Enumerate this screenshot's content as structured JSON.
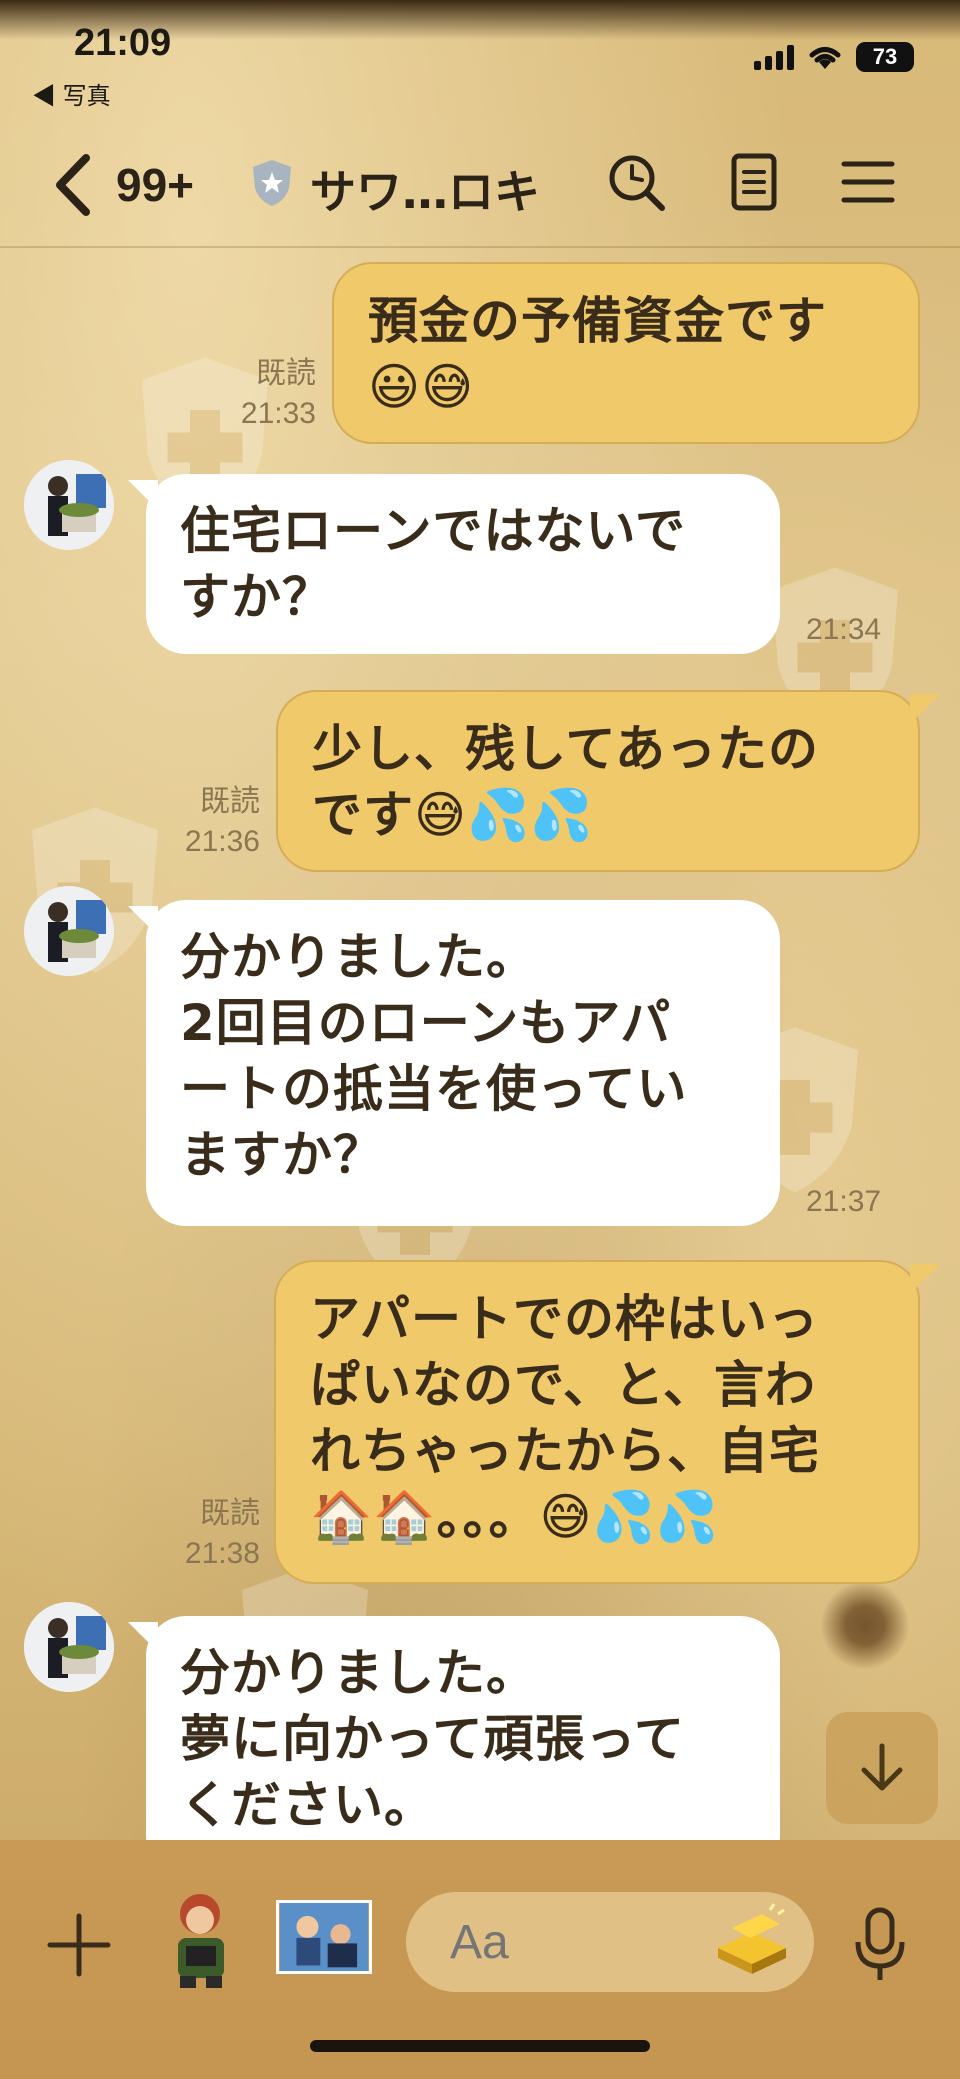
{
  "status_bar": {
    "time": "21:09",
    "back_app": "◀ 写真",
    "battery": "73"
  },
  "header": {
    "unread_count": "99+",
    "title": "サワ…ロキ"
  },
  "messages": [
    {
      "direction": "out",
      "lines": [
        "預金の予備資金です",
        "😃😅"
      ],
      "read": "既読",
      "time": "21:33"
    },
    {
      "direction": "in",
      "lines": [
        "住宅ローンではないで",
        "すか？"
      ],
      "time": "21:34"
    },
    {
      "direction": "out",
      "lines": [
        "少し、残してあったの",
        "です😅💦💦"
      ],
      "read": "既読",
      "time": "21:36"
    },
    {
      "direction": "in",
      "lines": [
        "分かりました。",
        "2回目のローンもアパ",
        "ートの抵当を使ってい",
        "ますか？"
      ],
      "time": "21:37"
    },
    {
      "direction": "out",
      "lines": [
        "アパートでの枠はいっ",
        "ぱいなので、と、言わ",
        "れちゃったから、自宅",
        "🏠🏠。。。😅💦💦"
      ],
      "read": "既読",
      "time": "21:38"
    },
    {
      "direction": "in",
      "lines": [
        "分かりました。",
        "夢に向かって頑張って",
        "ください。"
      ]
    }
  ],
  "input": {
    "placeholder": "Aa"
  },
  "colors": {
    "outgoing_bubble": "#f0c96b",
    "incoming_bubble": "#ffffff",
    "background": "#d9bb7a",
    "input_bar": "#c89a55"
  },
  "icons": [
    "back-chevron-icon",
    "shield-badge-icon",
    "search-icon",
    "notes-icon",
    "menu-icon",
    "scroll-down-icon",
    "plus-icon",
    "gold-bar-icon",
    "microphone-icon"
  ]
}
